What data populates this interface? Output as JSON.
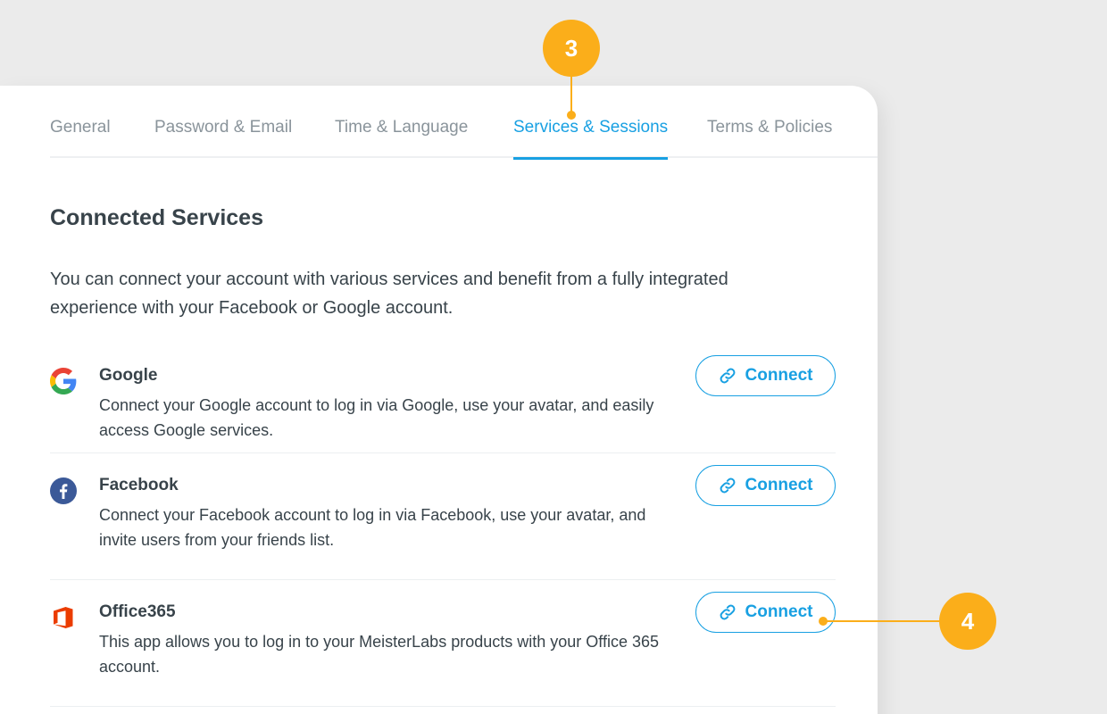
{
  "tabs": [
    {
      "label": "General",
      "active": false
    },
    {
      "label": "Password & Email",
      "active": false
    },
    {
      "label": "Time & Language",
      "active": false
    },
    {
      "label": "Services & Sessions",
      "active": true
    },
    {
      "label": "Terms & Policies",
      "active": false
    }
  ],
  "section": {
    "title": "Connected Services",
    "description": "You can connect your account with various services and benefit from a fully integrated experience with your Facebook or Google account."
  },
  "services": [
    {
      "name": "Google",
      "icon": "google-icon",
      "description": "Connect your Google account to log in via Google, use your avatar, and easily access Google services.",
      "button_label": "Connect"
    },
    {
      "name": "Facebook",
      "icon": "facebook-icon",
      "description": "Connect your Facebook account to log in via Facebook, use your avatar, and invite users from your friends list.",
      "button_label": "Connect"
    },
    {
      "name": "Office365",
      "icon": "office365-icon",
      "description": "This app allows you to log in to your MeisterLabs products with your Office 365 account.",
      "button_label": "Connect"
    }
  ],
  "callouts": [
    {
      "number": "3"
    },
    {
      "number": "4"
    }
  ],
  "colors": {
    "accent": "#18a0e2",
    "callout": "#fbae1a",
    "text": "#38434a",
    "muted": "#8a949b",
    "facebook": "#3b5998",
    "office": "#eb3c00"
  }
}
